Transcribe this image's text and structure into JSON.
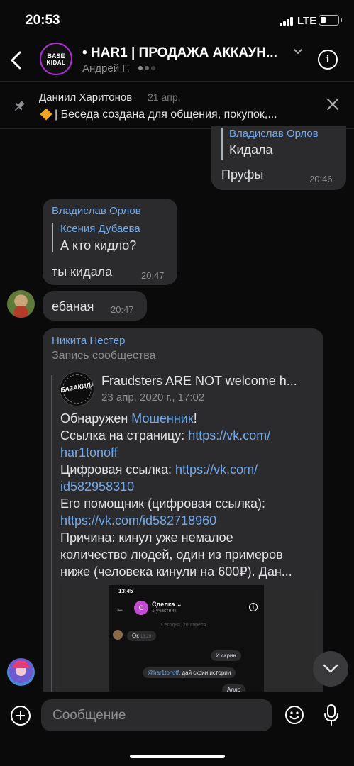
{
  "status_bar": {
    "time": "20:53",
    "network": "LTE",
    "battery_level": 0.3
  },
  "header": {
    "title": "• HAR1 | ПРОДАЖА АККАУН...",
    "subtitle": "Андрей Г.",
    "avatar_line1": "BASE",
    "avatar_line2": "KIDAL"
  },
  "pinned": {
    "author": "Даниил Харитонов",
    "date": "21 апр.",
    "text": "| Беседа создана для общения, покупок,..."
  },
  "messages": {
    "m1": {
      "quote_author": "Владислав Орлов",
      "quote_text": "Кидала",
      "text": "Пруфы",
      "time": "20:46"
    },
    "m2": {
      "author": "Владислав Орлов",
      "quote_author": "Ксения Дубаева",
      "quote_text": "А кто кидло?",
      "text": "ты кидала",
      "time": "20:47"
    },
    "m3": {
      "text": "ебаная",
      "time": "20:47"
    },
    "m4": {
      "author": "Никита Нестер",
      "subtitle": "Запись сообщества",
      "repost": {
        "avatar_label": "БАЗАКИДАЛ",
        "title": "Fraudsters ARE NOT welcome h...",
        "date": "23 апр. 2020 г., 17:02",
        "l1_text": "Обнаружен ",
        "l1_link": "Мошенник",
        "l1_end": "!",
        "l2_text": "Ссылка на страницу: ",
        "l2_link": "https://vk.com/",
        "l3_link": "har1tonoff",
        "l4_text": "Цифровая ссылка: ",
        "l4_link": "https://vk.com/",
        "l5_link": "id582958310",
        "l6_text": "Его помощник (цифровая ссылка):",
        "l7_link": "https://vk.com/id582718960",
        "l8_text": "Причина: кинул уже немалое",
        "l9_text": "количество людей, один из примеров",
        "l10_text": "ниже (человека кинули на 600₽). Дан..."
      },
      "screenshot": {
        "time": "13:45",
        "chat_title": "Сделка ⌄",
        "chat_sub": "1 участник",
        "avatar_letter": "С",
        "date": "Сегодня, 20 апреля",
        "b1": "Ок",
        "b1_time": "13:29",
        "b2": "И скрин",
        "b3_mention": "@har1tonoff",
        "b3_text": ", дай скрин истории",
        "b4": "Алло"
      }
    }
  },
  "composer": {
    "placeholder": "Сообщение"
  }
}
